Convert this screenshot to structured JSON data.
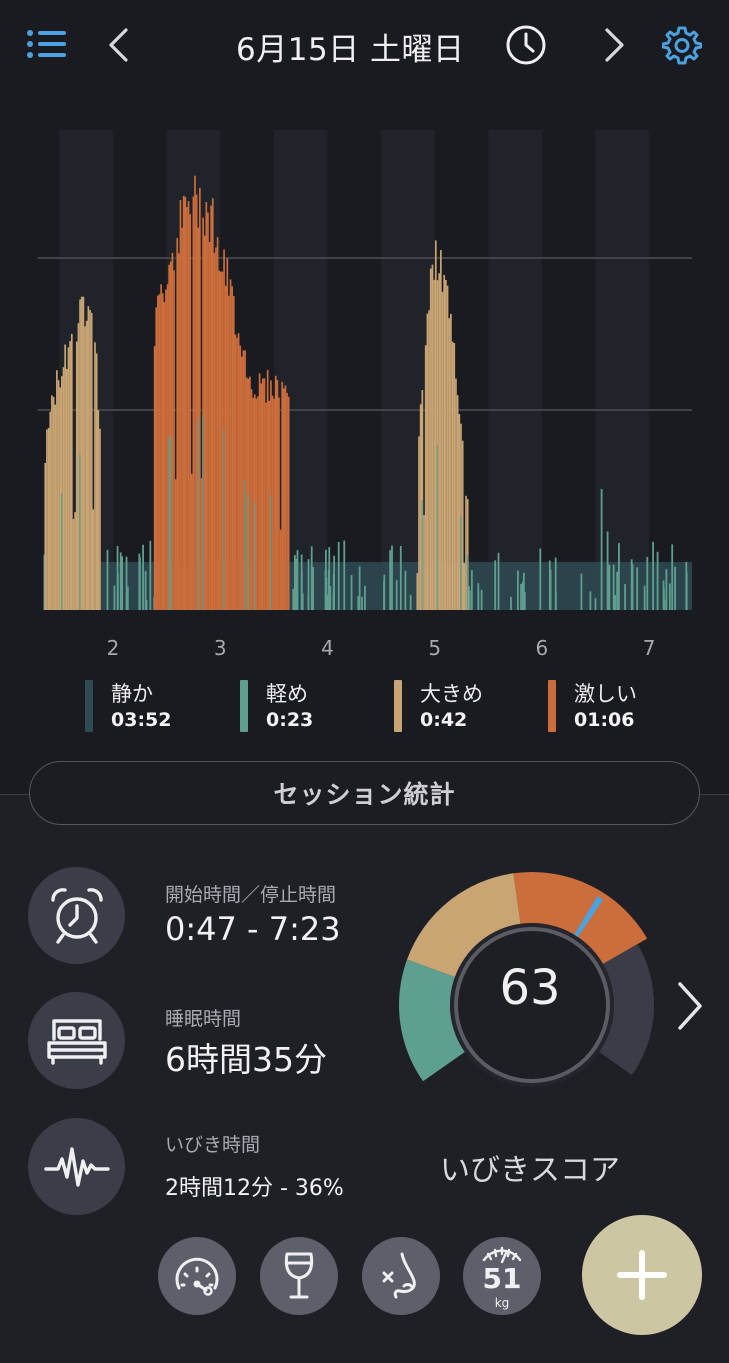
{
  "header": {
    "date": "6月15日 土曜日",
    "icons": [
      "menu-icon",
      "chevron-left-icon",
      "clock-icon",
      "chevron-right-icon",
      "gear-icon"
    ],
    "accent_color": "#4aa3e0"
  },
  "chart_data": {
    "type": "area",
    "x_ticks": [
      "2",
      "3",
      "4",
      "5",
      "6",
      "7"
    ],
    "x_range": [
      1.3,
      7.4
    ],
    "grid": true,
    "series_colors": {
      "静か": "#2f4a52",
      "軽め": "#5e9f90",
      "大きめ": "#c9a574",
      "激しい": "#cc6d3c"
    },
    "episodes": [
      {
        "start": 1.36,
        "end": 1.87,
        "peak": 0.83,
        "color": "#c9a574"
      },
      {
        "start": 2.38,
        "end": 3.63,
        "peak": 1.0,
        "color": "#cc6d3c"
      },
      {
        "start": 4.83,
        "end": 5.3,
        "peak": 0.85,
        "color": "#c9a574"
      }
    ]
  },
  "legend": [
    {
      "name": "静か",
      "value": "03:52",
      "color": "#2f4a52"
    },
    {
      "name": "軽め",
      "value": "0:23",
      "color": "#5e9f90"
    },
    {
      "name": "大きめ",
      "value": "0:42",
      "color": "#c9a574"
    },
    {
      "name": "激しい",
      "value": "01:06",
      "color": "#cc6d3c"
    }
  ],
  "session_button": "セッション統計",
  "stats": [
    {
      "label": "開始時間／停止時間",
      "value": "0:47 - 7:23",
      "icon": "alarm-clock-icon"
    },
    {
      "label": "睡眠時間",
      "value": "6時間35分",
      "icon": "bed-icon"
    },
    {
      "label": "いびき時間",
      "value": "2時間12分 - 36%",
      "icon": "waveform-icon"
    }
  ],
  "score": {
    "value": "63",
    "label": "いびきスコア",
    "value_fraction": 0.63
  },
  "bottom_buttons": [
    {
      "icon": "speedometer-icon"
    },
    {
      "icon": "wine-glass-icon"
    },
    {
      "icon": "nose-icon"
    },
    {
      "icon": "scale-icon",
      "weight": "51",
      "unit": "kg"
    }
  ],
  "fab": {
    "icon": "plus-icon",
    "color": "#cdc6a3"
  }
}
